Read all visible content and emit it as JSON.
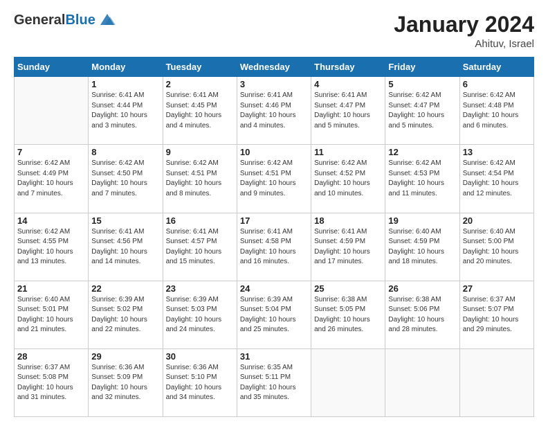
{
  "header": {
    "logo_general": "General",
    "logo_blue": "Blue",
    "month_title": "January 2024",
    "location": "Ahituv, Israel"
  },
  "weekdays": [
    "Sunday",
    "Monday",
    "Tuesday",
    "Wednesday",
    "Thursday",
    "Friday",
    "Saturday"
  ],
  "weeks": [
    [
      {
        "day": "",
        "info": ""
      },
      {
        "day": "1",
        "info": "Sunrise: 6:41 AM\nSunset: 4:44 PM\nDaylight: 10 hours\nand 3 minutes."
      },
      {
        "day": "2",
        "info": "Sunrise: 6:41 AM\nSunset: 4:45 PM\nDaylight: 10 hours\nand 4 minutes."
      },
      {
        "day": "3",
        "info": "Sunrise: 6:41 AM\nSunset: 4:46 PM\nDaylight: 10 hours\nand 4 minutes."
      },
      {
        "day": "4",
        "info": "Sunrise: 6:41 AM\nSunset: 4:47 PM\nDaylight: 10 hours\nand 5 minutes."
      },
      {
        "day": "5",
        "info": "Sunrise: 6:42 AM\nSunset: 4:47 PM\nDaylight: 10 hours\nand 5 minutes."
      },
      {
        "day": "6",
        "info": "Sunrise: 6:42 AM\nSunset: 4:48 PM\nDaylight: 10 hours\nand 6 minutes."
      }
    ],
    [
      {
        "day": "7",
        "info": "Sunrise: 6:42 AM\nSunset: 4:49 PM\nDaylight: 10 hours\nand 7 minutes."
      },
      {
        "day": "8",
        "info": "Sunrise: 6:42 AM\nSunset: 4:50 PM\nDaylight: 10 hours\nand 7 minutes."
      },
      {
        "day": "9",
        "info": "Sunrise: 6:42 AM\nSunset: 4:51 PM\nDaylight: 10 hours\nand 8 minutes."
      },
      {
        "day": "10",
        "info": "Sunrise: 6:42 AM\nSunset: 4:51 PM\nDaylight: 10 hours\nand 9 minutes."
      },
      {
        "day": "11",
        "info": "Sunrise: 6:42 AM\nSunset: 4:52 PM\nDaylight: 10 hours\nand 10 minutes."
      },
      {
        "day": "12",
        "info": "Sunrise: 6:42 AM\nSunset: 4:53 PM\nDaylight: 10 hours\nand 11 minutes."
      },
      {
        "day": "13",
        "info": "Sunrise: 6:42 AM\nSunset: 4:54 PM\nDaylight: 10 hours\nand 12 minutes."
      }
    ],
    [
      {
        "day": "14",
        "info": "Sunrise: 6:42 AM\nSunset: 4:55 PM\nDaylight: 10 hours\nand 13 minutes."
      },
      {
        "day": "15",
        "info": "Sunrise: 6:41 AM\nSunset: 4:56 PM\nDaylight: 10 hours\nand 14 minutes."
      },
      {
        "day": "16",
        "info": "Sunrise: 6:41 AM\nSunset: 4:57 PM\nDaylight: 10 hours\nand 15 minutes."
      },
      {
        "day": "17",
        "info": "Sunrise: 6:41 AM\nSunset: 4:58 PM\nDaylight: 10 hours\nand 16 minutes."
      },
      {
        "day": "18",
        "info": "Sunrise: 6:41 AM\nSunset: 4:59 PM\nDaylight: 10 hours\nand 17 minutes."
      },
      {
        "day": "19",
        "info": "Sunrise: 6:40 AM\nSunset: 4:59 PM\nDaylight: 10 hours\nand 18 minutes."
      },
      {
        "day": "20",
        "info": "Sunrise: 6:40 AM\nSunset: 5:00 PM\nDaylight: 10 hours\nand 20 minutes."
      }
    ],
    [
      {
        "day": "21",
        "info": "Sunrise: 6:40 AM\nSunset: 5:01 PM\nDaylight: 10 hours\nand 21 minutes."
      },
      {
        "day": "22",
        "info": "Sunrise: 6:39 AM\nSunset: 5:02 PM\nDaylight: 10 hours\nand 22 minutes."
      },
      {
        "day": "23",
        "info": "Sunrise: 6:39 AM\nSunset: 5:03 PM\nDaylight: 10 hours\nand 24 minutes."
      },
      {
        "day": "24",
        "info": "Sunrise: 6:39 AM\nSunset: 5:04 PM\nDaylight: 10 hours\nand 25 minutes."
      },
      {
        "day": "25",
        "info": "Sunrise: 6:38 AM\nSunset: 5:05 PM\nDaylight: 10 hours\nand 26 minutes."
      },
      {
        "day": "26",
        "info": "Sunrise: 6:38 AM\nSunset: 5:06 PM\nDaylight: 10 hours\nand 28 minutes."
      },
      {
        "day": "27",
        "info": "Sunrise: 6:37 AM\nSunset: 5:07 PM\nDaylight: 10 hours\nand 29 minutes."
      }
    ],
    [
      {
        "day": "28",
        "info": "Sunrise: 6:37 AM\nSunset: 5:08 PM\nDaylight: 10 hours\nand 31 minutes."
      },
      {
        "day": "29",
        "info": "Sunrise: 6:36 AM\nSunset: 5:09 PM\nDaylight: 10 hours\nand 32 minutes."
      },
      {
        "day": "30",
        "info": "Sunrise: 6:36 AM\nSunset: 5:10 PM\nDaylight: 10 hours\nand 34 minutes."
      },
      {
        "day": "31",
        "info": "Sunrise: 6:35 AM\nSunset: 5:11 PM\nDaylight: 10 hours\nand 35 minutes."
      },
      {
        "day": "",
        "info": ""
      },
      {
        "day": "",
        "info": ""
      },
      {
        "day": "",
        "info": ""
      }
    ]
  ]
}
